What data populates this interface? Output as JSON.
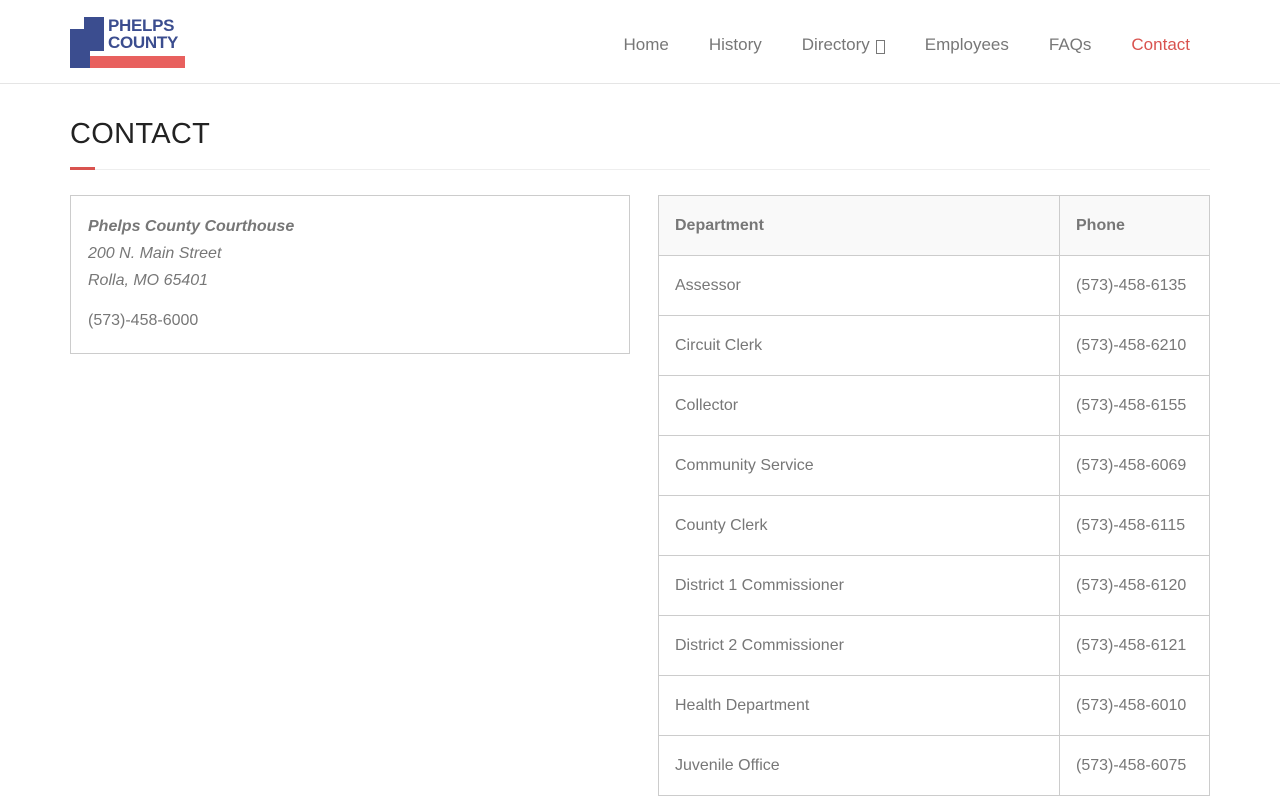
{
  "header": {
    "logo": {
      "line1": "PHELPS",
      "line2": "COUNTY"
    },
    "nav": [
      {
        "label": "Home",
        "active": false
      },
      {
        "label": "History",
        "active": false
      },
      {
        "label": "Directory",
        "active": false,
        "has_dropdown": true
      },
      {
        "label": "Employees",
        "active": false
      },
      {
        "label": "FAQs",
        "active": false
      },
      {
        "label": "Contact",
        "active": true
      }
    ]
  },
  "page": {
    "title": "CONTACT"
  },
  "address": {
    "name": "Phelps County Courthouse",
    "street": "200 N. Main Street",
    "city": "Rolla, MO 65401",
    "phone": "(573)-458-6000"
  },
  "directory": {
    "headers": {
      "department": "Department",
      "phone": "Phone"
    },
    "rows": [
      {
        "department": "Assessor",
        "phone": "(573)-458-6135"
      },
      {
        "department": "Circuit Clerk",
        "phone": "(573)-458-6210"
      },
      {
        "department": "Collector",
        "phone": "(573)-458-6155"
      },
      {
        "department": "Community Service",
        "phone": "(573)-458-6069"
      },
      {
        "department": "County Clerk",
        "phone": "(573)-458-6115"
      },
      {
        "department": "District 1 Commissioner",
        "phone": "(573)-458-6120"
      },
      {
        "department": "District 2 Commissioner",
        "phone": "(573)-458-6121"
      },
      {
        "department": "Health Department",
        "phone": "(573)-458-6010"
      },
      {
        "department": "Juvenile Office",
        "phone": "(573)-458-6075"
      }
    ]
  },
  "colors": {
    "accent": "#d9534f",
    "brand_blue": "#3b4d8f",
    "brand_red": "#e8605e",
    "text": "#777777"
  },
  "icons": {
    "directory_dropdown": "dropdown-caret-icon"
  }
}
